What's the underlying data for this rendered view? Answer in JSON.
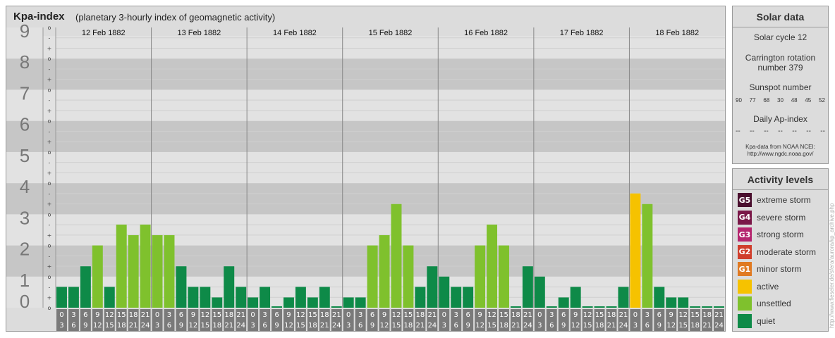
{
  "header": {
    "title": "Kpa-index",
    "subtitle": "(planetary 3-hourly index of geomagnetic activity)"
  },
  "solar": {
    "title": "Solar data",
    "cycle": "Solar cycle 12",
    "rotation_line1": "Carrington rotation",
    "rotation_line2": "number 379",
    "sunspot_label": "Sunspot number",
    "sunspot_values": [
      "90",
      "77",
      "68",
      "30",
      "48",
      "45",
      "52"
    ],
    "ap_label": "Daily Ap-index",
    "ap_values": [
      "--",
      "--",
      "--",
      "--",
      "--",
      "--",
      "--"
    ],
    "source_line1": "Kpa-data from NOAA NCEI:",
    "source_line2": "http://www.ngdc.noaa.gov/"
  },
  "activity": {
    "title": "Activity levels",
    "levels": [
      {
        "code": "G5",
        "label": "extreme storm",
        "color": "#4a0f2e"
      },
      {
        "code": "G4",
        "label": "severe storm",
        "color": "#7a1848"
      },
      {
        "code": "G3",
        "label": "strong storm",
        "color": "#b5256e"
      },
      {
        "code": "G2",
        "label": "moderate storm",
        "color": "#d03e2c"
      },
      {
        "code": "G1",
        "label": "minor storm",
        "color": "#e07a22"
      },
      {
        "code": "",
        "label": "active",
        "color": "#f6c200"
      },
      {
        "code": "",
        "label": "unsettled",
        "color": "#7fc12d"
      },
      {
        "code": "",
        "label": "quiet",
        "color": "#0e8a48"
      }
    ]
  },
  "credit": "http://www.fieseler.de/sfera/aurora/kp_archive.php",
  "chart_data": {
    "type": "bar",
    "ylim": [
      0,
      9
    ],
    "y_ticks": [
      "0",
      "1",
      "2",
      "3",
      "4",
      "5",
      "6",
      "7",
      "8",
      "9"
    ],
    "sub_ticks": [
      "-",
      "o",
      "+"
    ],
    "days": [
      "12 Feb 1882",
      "13 Feb 1882",
      "14 Feb 1882",
      "15 Feb 1882",
      "16 Feb 1882",
      "17 Feb 1882",
      "18 Feb 1882"
    ],
    "interval_start": [
      "0",
      "3",
      "6",
      "9",
      "12",
      "15",
      "18",
      "21"
    ],
    "interval_end": [
      "3",
      "6",
      "9",
      "12",
      "15",
      "18",
      "21",
      "24"
    ],
    "kp_values": [
      [
        0.67,
        0.67,
        1.33,
        2.0,
        0.67,
        2.67,
        2.33,
        2.67
      ],
      [
        2.33,
        2.33,
        1.33,
        0.67,
        0.67,
        0.33,
        1.33,
        0.67
      ],
      [
        0.33,
        0.67,
        0,
        0.33,
        0.67,
        0.33,
        0.67,
        0
      ],
      [
        0.33,
        0.33,
        2.0,
        2.33,
        3.33,
        2.0,
        0.67,
        1.33
      ],
      [
        1.0,
        0.67,
        0.67,
        2.0,
        2.67,
        2.0,
        0,
        1.33
      ],
      [
        1.0,
        0,
        0.33,
        0.67,
        0,
        0,
        0,
        0.67
      ],
      [
        3.67,
        3.33,
        0.67,
        0.33,
        0.33,
        0,
        0,
        0
      ]
    ],
    "colors": {
      "quiet": "#0e8a48",
      "unsettled": "#7fc12d",
      "active": "#f6c200"
    }
  }
}
